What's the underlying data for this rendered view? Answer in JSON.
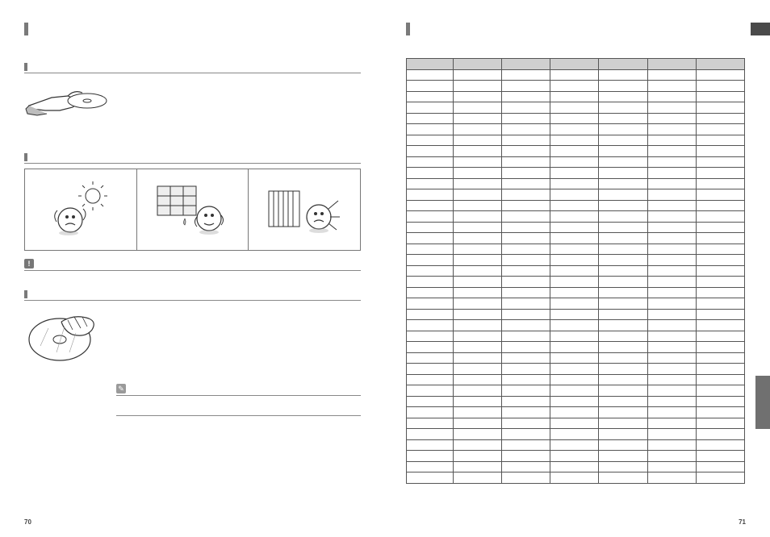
{
  "left": {
    "s1": {
      "title": ""
    },
    "s2": {
      "title": ""
    },
    "s3": {
      "title": ""
    },
    "note": "",
    "pageNum": "70"
  },
  "right": {
    "pageNum": "71",
    "table": {
      "cols": 7,
      "headers": [
        "",
        "",
        "",
        "",
        "",
        "",
        ""
      ],
      "rows": 38
    }
  },
  "icons": {
    "caution": "!",
    "pencil": "✎"
  }
}
